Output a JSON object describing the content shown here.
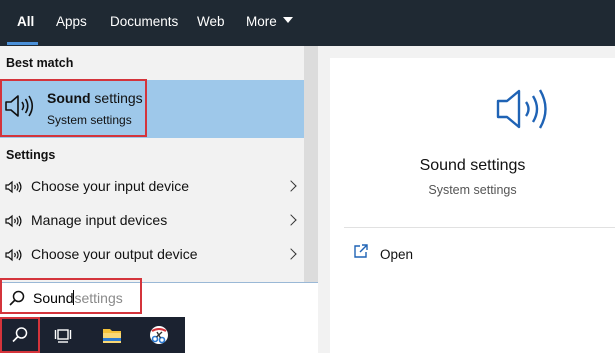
{
  "tabs": [
    {
      "label": "All",
      "active": true
    },
    {
      "label": "Apps"
    },
    {
      "label": "Documents"
    },
    {
      "label": "Web"
    },
    {
      "label": "More"
    }
  ],
  "best_match": {
    "heading": "Best match",
    "title_bold": "Sound",
    "title_rest": " settings",
    "subtitle": "System settings",
    "icon": "speaker-icon"
  },
  "settings": {
    "heading": "Settings",
    "items": [
      {
        "label": "Choose your input device",
        "icon": "speaker-icon"
      },
      {
        "label": "Manage input devices",
        "icon": "speaker-icon"
      },
      {
        "label": "Choose your output device",
        "icon": "speaker-icon"
      }
    ]
  },
  "search": {
    "typed": "Sound",
    "suggestion": "settings"
  },
  "preview": {
    "title": "Sound settings",
    "subtitle": "System settings",
    "icon": "speaker-icon"
  },
  "actions": [
    {
      "label": "Open",
      "icon": "open-icon"
    }
  ],
  "taskbar": [
    {
      "name": "search-icon"
    },
    {
      "name": "task-view-icon"
    },
    {
      "name": "file-explorer-icon"
    },
    {
      "name": "snipping-tool-icon"
    }
  ],
  "colors": {
    "topbar": "#1f2933",
    "highlight": "#9ec8ea",
    "accent": "#4a90d9",
    "annotation_red": "#d4343b"
  }
}
